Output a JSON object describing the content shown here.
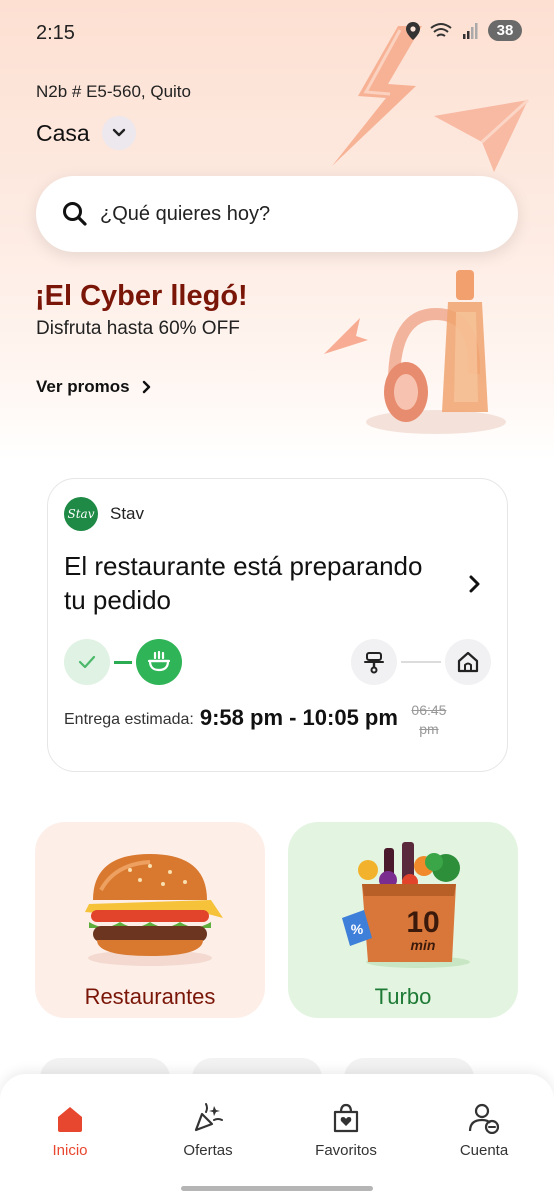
{
  "status_bar": {
    "time": "2:15",
    "battery": "38"
  },
  "header": {
    "address": "N2b # E5-560, Quito",
    "location_name": "Casa"
  },
  "search": {
    "placeholder": "¿Qué quieres hoy?"
  },
  "promo": {
    "title": "¡El Cyber llegó!",
    "subtitle": "Disfruta hasta 60% OFF",
    "link": "Ver promos"
  },
  "order": {
    "store_logo_text": "Stav",
    "store_name": "Stav",
    "status": "El restaurante está preparando tu pedido",
    "eta_label": "Entrega estimada:",
    "eta_value": "9:58 pm - 10:05 pm",
    "eta_old": "06:45 pm"
  },
  "categories": [
    {
      "label": "Restaurantes"
    },
    {
      "label": "Turbo"
    }
  ],
  "turbo_bag_text": "10 min",
  "nav": [
    {
      "label": "Inicio"
    },
    {
      "label": "Ofertas"
    },
    {
      "label": "Favoritos"
    },
    {
      "label": "Cuenta"
    }
  ],
  "colors": {
    "accent": "#e8472f",
    "promo_title": "#7a1608",
    "success": "#2fb457",
    "turbo_text": "#1f7a36"
  }
}
